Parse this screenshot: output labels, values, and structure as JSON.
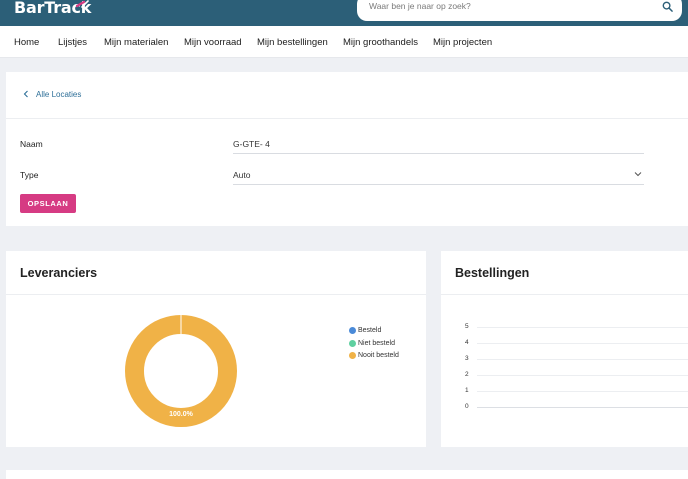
{
  "app": {
    "logo_text": "BarTrack"
  },
  "search": {
    "placeholder": "Waar ben je naar op zoek?"
  },
  "nav": {
    "items": [
      "Home",
      "Lijstjes",
      "Mijn materialen",
      "Mijn voorraad",
      "Mijn bestellingen",
      "Mijn groothandels",
      "Mijn projecten"
    ]
  },
  "breadcrumb": {
    "back_label": "Alle Locaties"
  },
  "form": {
    "name_label": "Naam",
    "name_value": "G-GTE- 4",
    "type_label": "Type",
    "type_value": "Auto",
    "save_label": "OPSLAAN"
  },
  "colors": {
    "accent": "#d63b83",
    "brand": "#2c5f78",
    "link": "#2e6f98"
  },
  "suppliers": {
    "title": "Leveranciers",
    "chart_data": {
      "type": "pie",
      "labels": [
        "Besteld",
        "Niet besteld",
        "Nooit besteld"
      ],
      "values": [
        0,
        0,
        100
      ],
      "colors": [
        "#4a8ad8",
        "#5fd0a0",
        "#f0b247"
      ],
      "data_label": "100.0%",
      "legend_position": "right"
    }
  },
  "orders": {
    "title": "Bestellingen",
    "chart_data": {
      "type": "line",
      "yticks": [
        "5",
        "4",
        "3",
        "2",
        "1",
        "0"
      ],
      "ylim": [
        0,
        5
      ],
      "series": []
    }
  }
}
